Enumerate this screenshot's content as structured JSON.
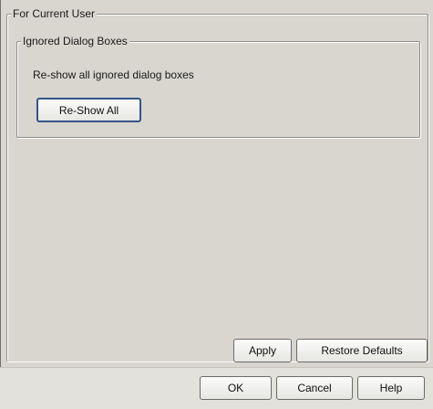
{
  "outer_group": {
    "legend": "For Current User"
  },
  "inner_group": {
    "legend": "Ignored Dialog Boxes",
    "description": "Re-show all ignored dialog boxes",
    "reshow_button": "Re-Show All"
  },
  "panel_actions": {
    "apply": "Apply",
    "restore_defaults": "Restore Defaults"
  },
  "dialog_actions": {
    "ok": "OK",
    "cancel": "Cancel",
    "help": "Help"
  }
}
